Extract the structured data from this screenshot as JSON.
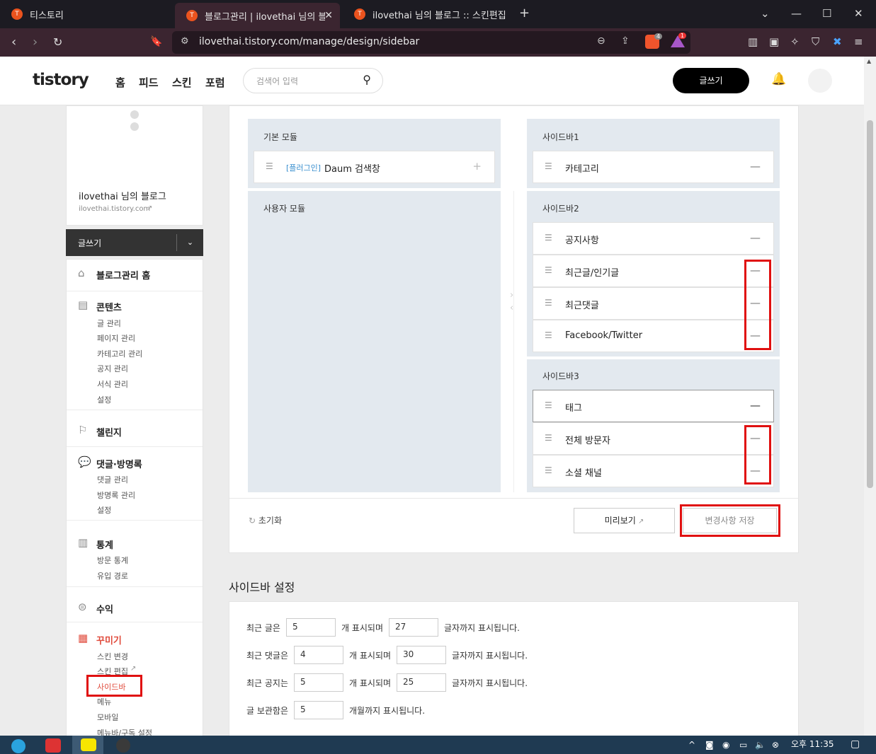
{
  "browser": {
    "tabs": [
      {
        "label": "티스토리",
        "active": false
      },
      {
        "label": "블로그관리 | ilovethai 님의 블",
        "active": true
      },
      {
        "label": "ilovethai 님의 블로그 :: 스킨편집",
        "active": false
      }
    ],
    "url": "ilovethai.tistory.com/manage/design/sidebar",
    "badges": {
      "brave": "4",
      "alert": "1"
    }
  },
  "header": {
    "logo": "tistory",
    "nav": [
      "홈",
      "피드",
      "스킨",
      "포럼"
    ],
    "search_placeholder": "검색어 입력",
    "write_label": "글쓰기"
  },
  "sidebar": {
    "blog_name": "ilovethai 님의 블로그",
    "blog_url": "ilovethai.tistory.com",
    "write_label": "글쓰기",
    "sections": [
      {
        "title": "블로그관리 홈",
        "icon": "home-icon",
        "items": []
      },
      {
        "title": "콘텐츠",
        "icon": "document-icon",
        "items": [
          "글 관리",
          "페이지 관리",
          "카테고리 관리",
          "공지 관리",
          "서식 관리",
          "설정"
        ]
      },
      {
        "title": "챌린지",
        "icon": "flag-icon",
        "items": []
      },
      {
        "title": "댓글·방명록",
        "icon": "comment-icon",
        "items": [
          "댓글 관리",
          "방명록 관리",
          "설정"
        ]
      },
      {
        "title": "통계",
        "icon": "chart-icon",
        "items": [
          "방문 통계",
          "유입 경로"
        ]
      },
      {
        "title": "수익",
        "icon": "coin-icon",
        "items": []
      },
      {
        "title": "꾸미기",
        "icon": "layout-icon",
        "items": [
          "스킨 변경",
          "스킨 편집",
          "사이드바",
          "메뉴",
          "모바일",
          "메뉴바/구독 설정"
        ]
      }
    ]
  },
  "modules": {
    "basic_title": "기본 모듈",
    "basic_items": [
      {
        "tag": "[플러그인]",
        "label": "Daum 검색창"
      }
    ],
    "user_title": "사용자 모듈"
  },
  "sidebars": [
    {
      "title": "사이드바1",
      "items": [
        "카테고리"
      ]
    },
    {
      "title": "사이드바2",
      "items": [
        "공지사항",
        "최근글/인기글",
        "최근댓글",
        "Facebook/Twitter"
      ]
    },
    {
      "title": "사이드바3",
      "items": [
        "태그",
        "전체 방문자",
        "소셜 채널"
      ]
    }
  ],
  "footer": {
    "reset": "초기화",
    "preview": "미리보기",
    "save": "변경사항 저장"
  },
  "settings": {
    "title": "사이드바 설정",
    "rows": [
      {
        "a": "최근 글은",
        "v1": "5",
        "b": "개 표시되며",
        "v2": "27",
        "c": "글자까지 표시됩니다."
      },
      {
        "a": "최근 댓글은",
        "v1": "4",
        "b": "개 표시되며",
        "v2": "30",
        "c": "글자까지 표시됩니다."
      },
      {
        "a": "최근 공지는",
        "v1": "5",
        "b": "개 표시되며",
        "v2": "25",
        "c": "글자까지 표시됩니다."
      },
      {
        "a": "글 보관함은",
        "v1": "5",
        "b": "개월까지 표시됩니다."
      }
    ]
  },
  "taskbar": {
    "time": "오후 11:35"
  }
}
